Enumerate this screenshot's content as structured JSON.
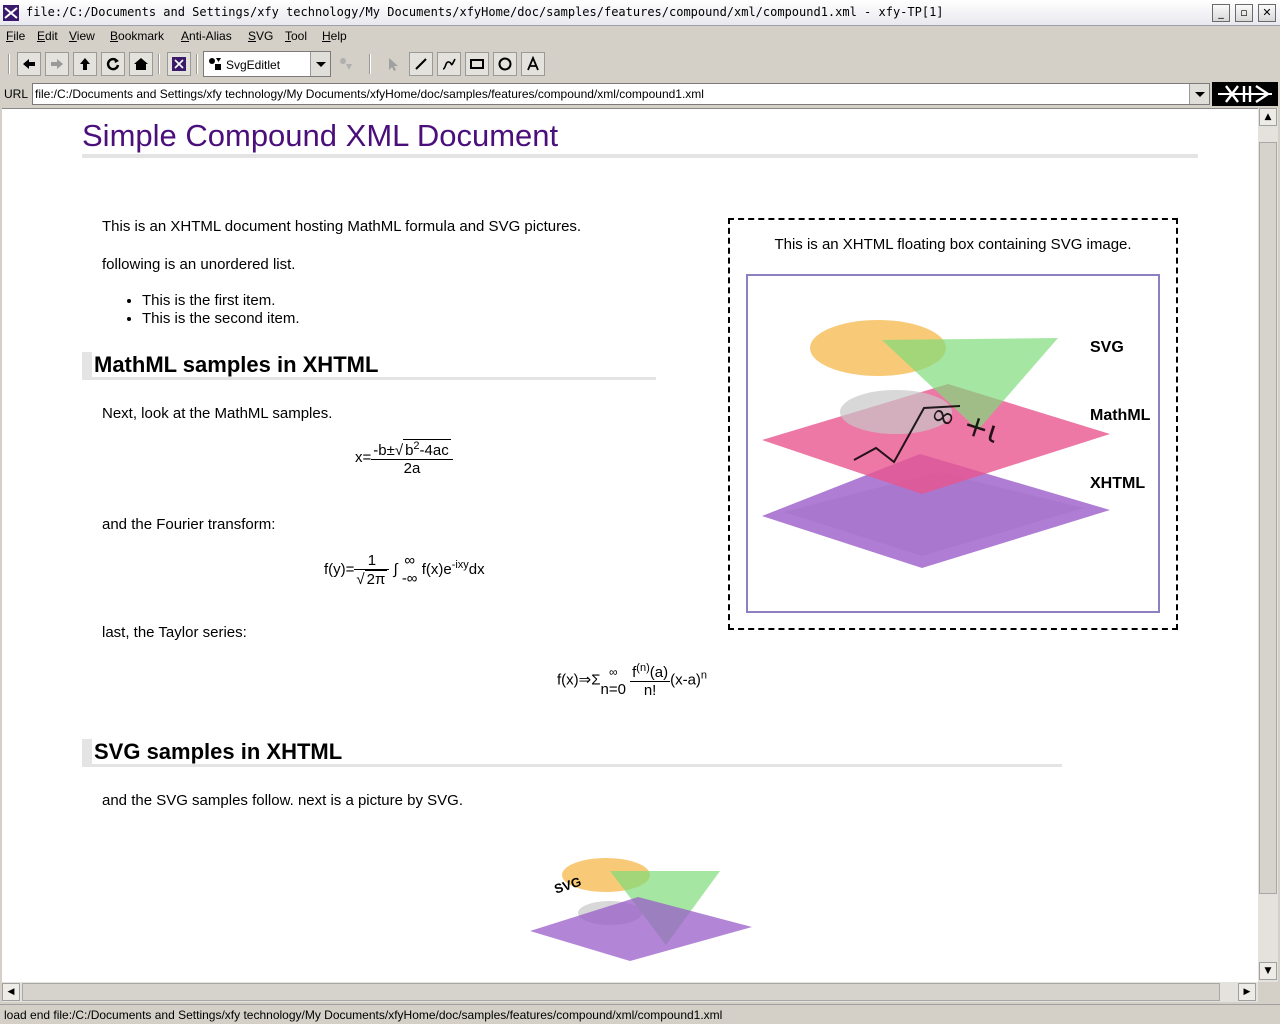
{
  "window": {
    "title": "file:/C:/Documents and Settings/xfy technology/My Documents/xfyHome/doc/samples/features/compound/xml/compound1.xml - xfy-TP[1]",
    "controls": [
      "_",
      "▫",
      "✕"
    ]
  },
  "menu": [
    "File",
    "Edit",
    "View",
    "Bookmark",
    "Anti-Alias",
    "SVG",
    "Tool",
    "Help"
  ],
  "toolbar": {
    "editlet": "SvgEditlet"
  },
  "url": {
    "label": "URL",
    "value": "file:/C:/Documents and Settings/xfy technology/My Documents/xfyHome/doc/samples/features/compound/xml/compound1.xml"
  },
  "document": {
    "title": "Simple Compound XML Document",
    "intro": "This is an XHTML document hosting MathML formula and SVG pictures.",
    "list_intro": "following is an unordered list.",
    "list_items": [
      "This is the first item.",
      "This is the second item."
    ],
    "mathml_heading": "MathML samples in XHTML",
    "mathml_intro": "Next, look at the MathML samples.",
    "fourier_intro": "and the Fourier transform:",
    "taylor_intro": "last, the Taylor series:",
    "svg_heading": "SVG samples in XHTML",
    "svg_intro": "and the SVG samples follow. next is a picture by SVG.",
    "float_box_text": "This is an XHTML floating box containing SVG image.",
    "diagram_labels": [
      "SVG",
      "MathML",
      "XHTML"
    ],
    "small_svg_label": "SVG"
  },
  "formulas": {
    "quadratic": {
      "lhs": "x=",
      "num_pre": "-b±",
      "radicand_base": "b",
      "radicand_exp": "2",
      "radicand_rest": "-4ac",
      "den": "2a"
    },
    "fourier": {
      "lhs": "f(y)=",
      "num": "1",
      "den_rad": "2π",
      "integral": "∫",
      "upper": "∞",
      "lower": "-∞",
      "body": "f(x)e",
      "exp": "-ixy",
      "dx": "dx"
    },
    "taylor": {
      "lhs": "f(x)⇒Σ",
      "upper": "∞",
      "lower": "n=0",
      "num_base": "f",
      "num_sup": "(n)",
      "num_arg": "(a)",
      "den": "n!",
      "tail": "(x-a)",
      "tail_exp": "n"
    }
  },
  "status": "load end file:/C:/Documents and Settings/xfy technology/My Documents/xfyHome/doc/samples/features/compound/xml/compound1.xml",
  "colors": {
    "title": "#4b0f7c",
    "accent": "#8d7fc1"
  }
}
